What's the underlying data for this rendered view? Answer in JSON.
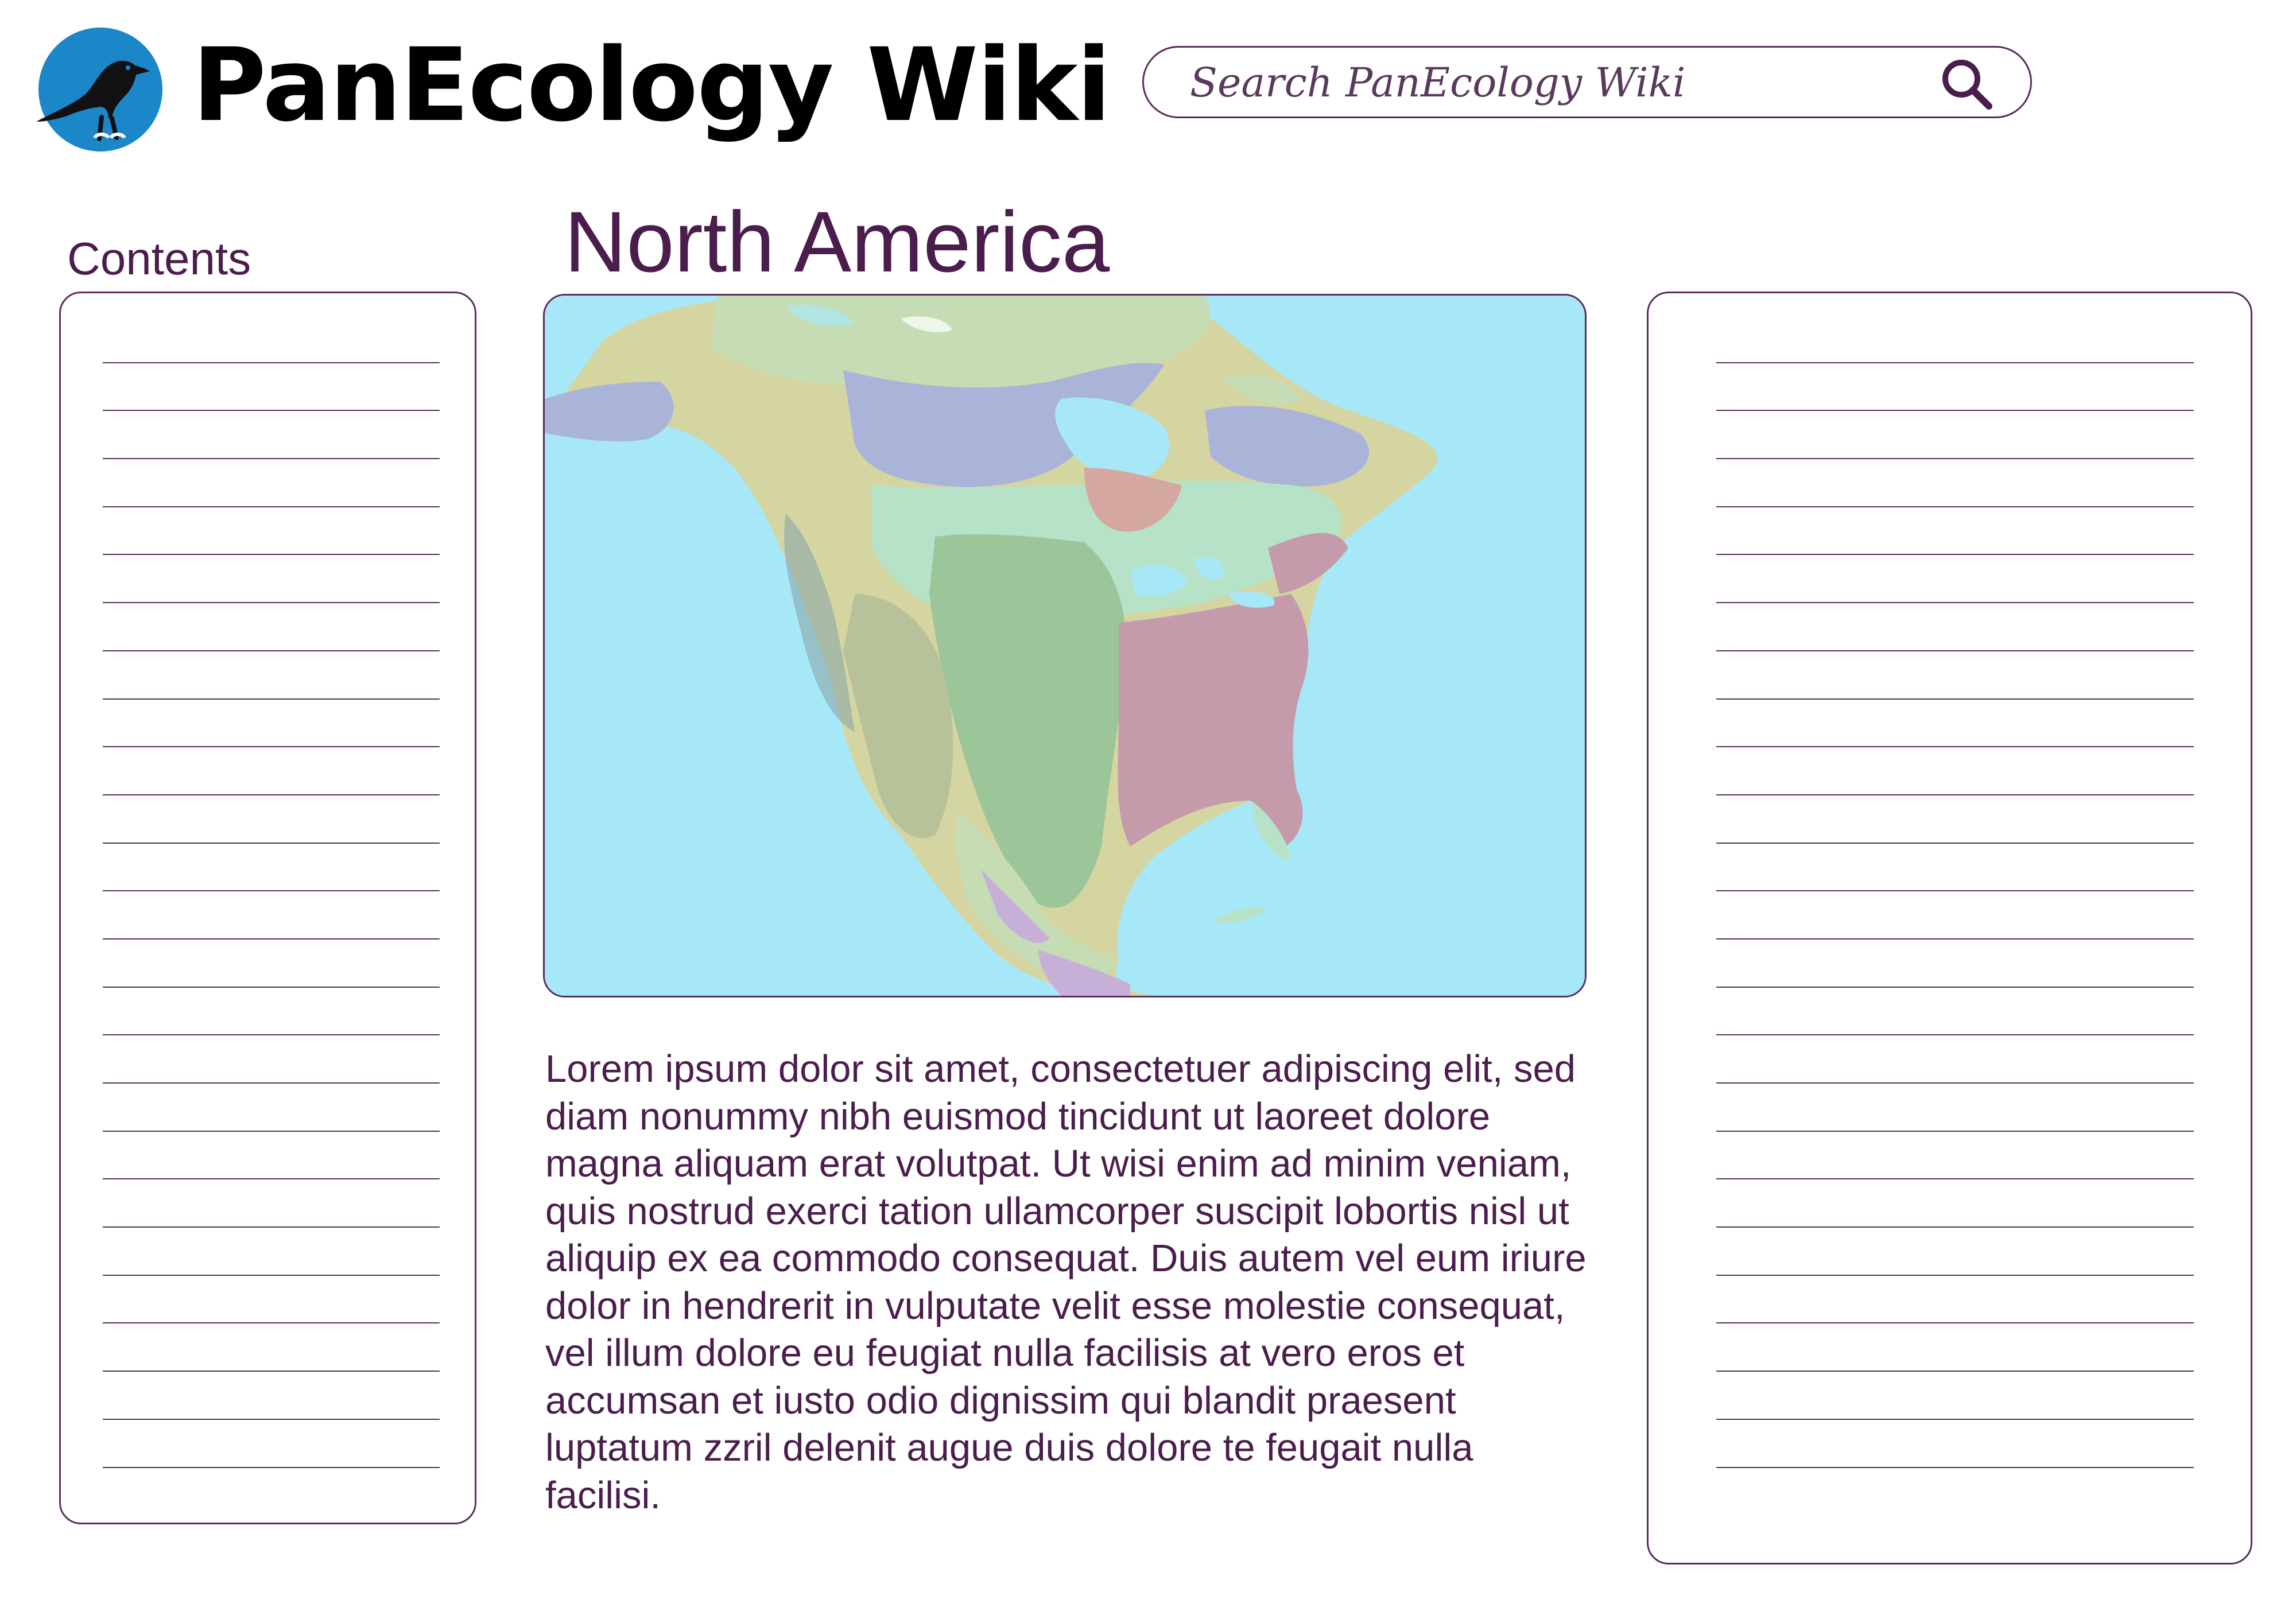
{
  "header": {
    "site_title": "PanEcology Wiki",
    "logo_icon": "raven-logo-icon",
    "search": {
      "placeholder": "Search PanEcology Wiki",
      "value": "",
      "icon": "search-icon"
    }
  },
  "sidebar": {
    "contents_label": "Contents",
    "items": []
  },
  "main": {
    "page_title": "North America",
    "map_image": "north-america-ecoregion-map",
    "body_text": "Lorem ipsum dolor sit amet, consectetuer adipiscing elit, sed diam nonummy nibh euismod tincidunt ut laoreet dolore magna aliquam erat volutpat. Ut wisi enim ad minim veniam, quis nostrud exerci tation ullamcorper suscipit lobortis nisl ut aliquip ex ea commodo consequat. Duis autem vel eum iriure dolor in hendrerit in vulputate velit esse molestie consequat, vel illum dolore eu feugiat nulla facilisis at vero eros et accumsan et iusto odio dignissim qui blandit praesent luptatum zzril delenit augue duis dolore te feugait nulla facilisi."
  },
  "right_panel": {
    "items": []
  },
  "colors": {
    "accent": "#4a1d4c",
    "logo_blue": "#1b86c8",
    "ocean": "#a7e8f8",
    "tundra": "#c5dcb4",
    "boreal": "#aab4d8",
    "temperate_forest": "#c59aab",
    "grassland": "#9cc59a",
    "mixed_forest": "#b6e3c8",
    "mountain": "#d4d5a1",
    "desert": "#b7c19a"
  }
}
